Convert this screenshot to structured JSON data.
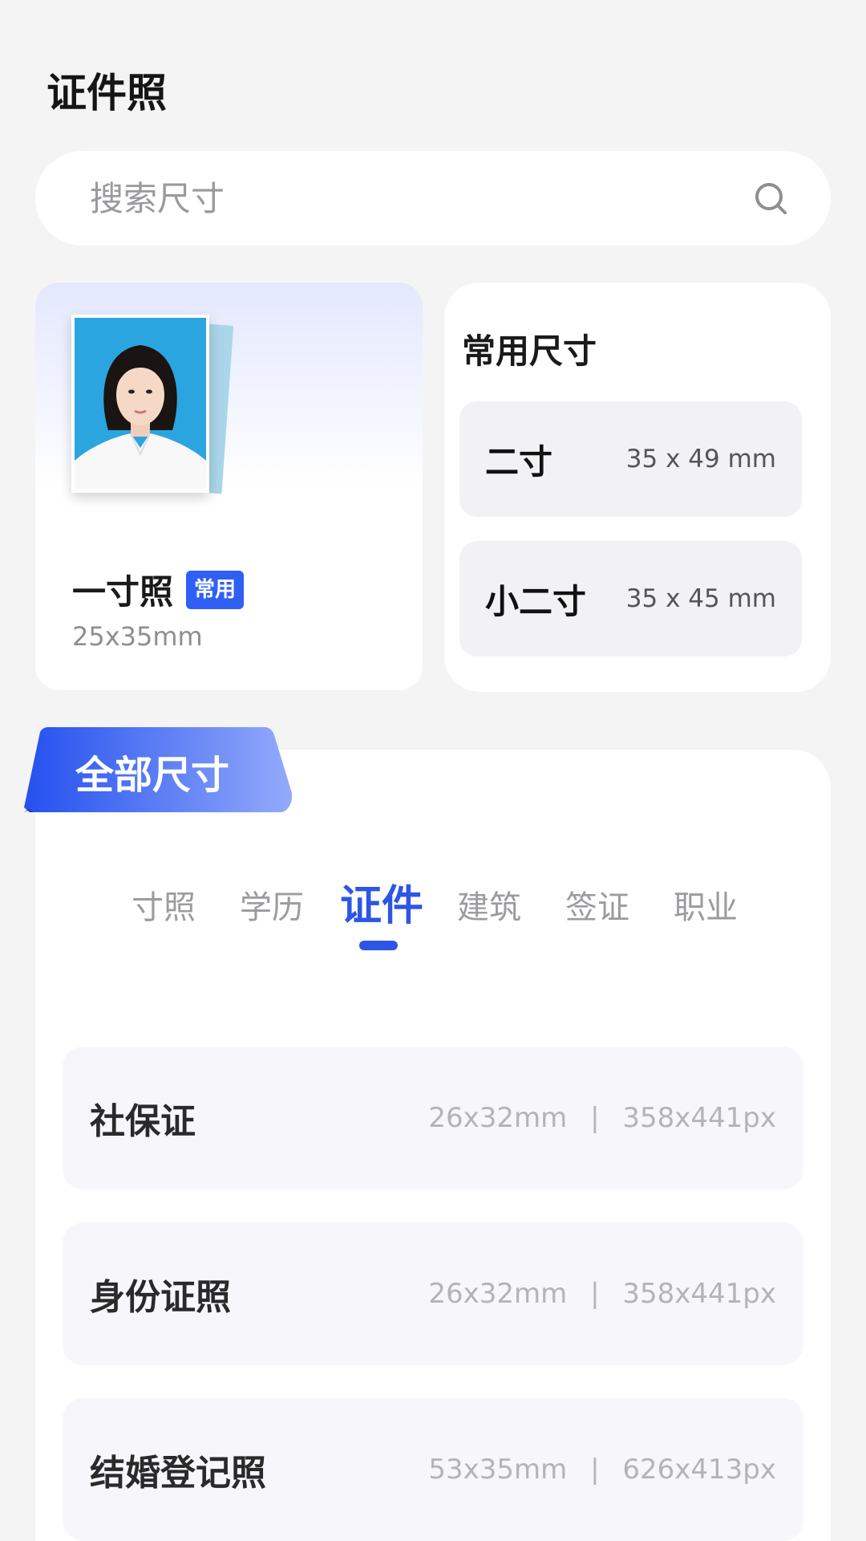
{
  "header": {
    "title": "证件照"
  },
  "search": {
    "placeholder": "搜索尺寸",
    "icon": "search-icon"
  },
  "featured": {
    "name": "一寸照",
    "badge": "常用",
    "size": "25x35mm",
    "accent": "#2f5ff5"
  },
  "common_sizes": {
    "title": "常用尺寸",
    "items": [
      {
        "name": "二寸",
        "dims": "35 x 49 mm"
      },
      {
        "name": "小二寸",
        "dims": "35 x 45 mm"
      }
    ]
  },
  "all_sizes": {
    "title": "全部尺寸",
    "tabs": [
      {
        "label": "寸照"
      },
      {
        "label": "学历"
      },
      {
        "label": "证件",
        "active": true
      },
      {
        "label": "建筑"
      },
      {
        "label": "签证"
      },
      {
        "label": "职业"
      }
    ],
    "items": [
      {
        "name": "社保证",
        "mm": "26x32mm",
        "separator": "|",
        "px": "358x441px"
      },
      {
        "name": "身份证照",
        "mm": "26x32mm",
        "separator": "|",
        "px": "358x441px"
      },
      {
        "name": "结婚登记照",
        "mm": "53x35mm",
        "separator": "|",
        "px": "626x413px"
      }
    ]
  },
  "colors": {
    "accent": "#2d55e6",
    "background": "#f4f4f5",
    "card": "#ffffff",
    "photo_background": "#2aa5e0"
  }
}
